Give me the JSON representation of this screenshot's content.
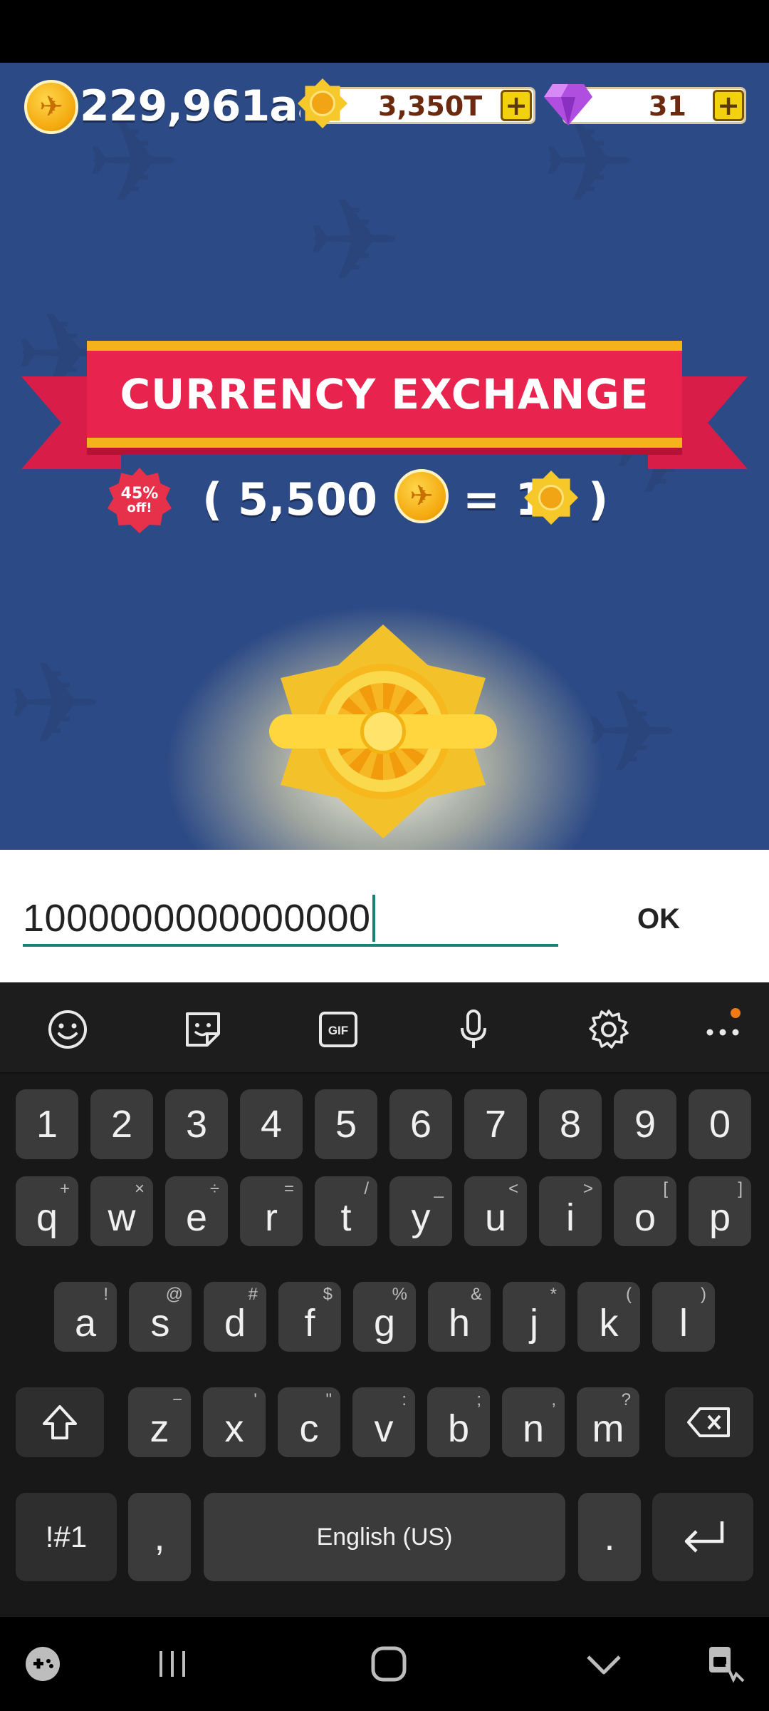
{
  "game": {
    "gold_amount": "229,961aa",
    "medal_amount": "3,350T",
    "gem_amount": "31",
    "plus_glyph": "+",
    "title": "CURRENCY EXCHANGE",
    "discount_percent": "45%",
    "discount_off": "off!",
    "rate_left": "( 5,500",
    "rate_equals": "= 1",
    "rate_right": ")"
  },
  "dialog": {
    "input_value": "1000000000000000",
    "ok_label": "OK"
  },
  "keyboard": {
    "toolbar_icons": [
      "emoji-icon",
      "sticker-icon",
      "gif-icon",
      "microphone-icon",
      "settings-icon",
      "more-icon"
    ],
    "gif_label": "GIF",
    "number_row": [
      "1",
      "2",
      "3",
      "4",
      "5",
      "6",
      "7",
      "8",
      "9",
      "0"
    ],
    "row1": [
      {
        "k": "q",
        "h": "+"
      },
      {
        "k": "w",
        "h": "×"
      },
      {
        "k": "e",
        "h": "÷"
      },
      {
        "k": "r",
        "h": "="
      },
      {
        "k": "t",
        "h": "/"
      },
      {
        "k": "y",
        "h": "_"
      },
      {
        "k": "u",
        "h": "<"
      },
      {
        "k": "i",
        "h": ">"
      },
      {
        "k": "o",
        "h": "["
      },
      {
        "k": "p",
        "h": "]"
      }
    ],
    "row2": [
      {
        "k": "a",
        "h": "!"
      },
      {
        "k": "s",
        "h": "@"
      },
      {
        "k": "d",
        "h": "#"
      },
      {
        "k": "f",
        "h": "$"
      },
      {
        "k": "g",
        "h": "%"
      },
      {
        "k": "h",
        "h": "&"
      },
      {
        "k": "j",
        "h": "*"
      },
      {
        "k": "k",
        "h": "("
      },
      {
        "k": "l",
        "h": ")"
      }
    ],
    "row3": [
      {
        "k": "z",
        "h": "−"
      },
      {
        "k": "x",
        "h": "'"
      },
      {
        "k": "c",
        "h": "\""
      },
      {
        "k": "v",
        "h": ":"
      },
      {
        "k": "b",
        "h": ";"
      },
      {
        "k": "n",
        "h": ","
      },
      {
        "k": "m",
        "h": "?"
      }
    ],
    "symbols_label": "!#1",
    "comma_label": ",",
    "space_label": "English (US)",
    "period_label": ".",
    "shift_icon": "shift-icon",
    "backspace_icon": "backspace-icon",
    "enter_icon": "enter-icon"
  },
  "navbar": {
    "icons": [
      "game-tools-icon",
      "recent-apps-icon",
      "home-icon",
      "hide-keyboard-icon",
      "keyboard-switch-icon"
    ]
  },
  "colors": {
    "game_background": "#2c4a86",
    "banner_red": "#e8234e",
    "banner_gold": "#f5b21b",
    "input_accent": "#198275",
    "key_background": "#3b3b3b",
    "notification_dot": "#f07a18"
  }
}
